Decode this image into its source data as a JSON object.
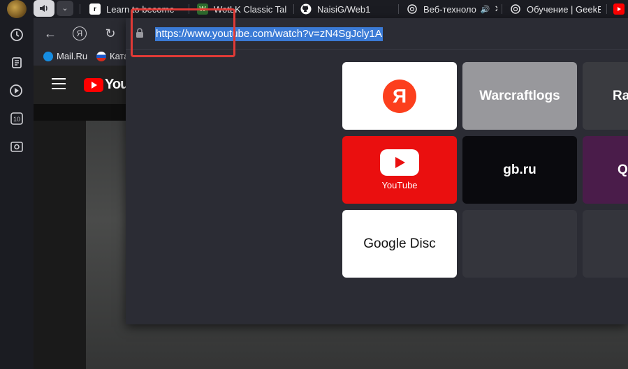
{
  "tabs": [
    {
      "title": "Learn to become",
      "favicon": "r"
    },
    {
      "title": "WotLK Classic Tale",
      "favicon": "W"
    },
    {
      "title": "NaisiG/Web1",
      "favicon": "github"
    },
    {
      "title": "Веб-техноло",
      "favicon": "openai"
    },
    {
      "title": "Обучение | GeekB",
      "favicon": "openai"
    }
  ],
  "toolbar": {
    "back": "←",
    "yandex": "Я",
    "reload": "↻"
  },
  "address": {
    "url": "https://www.youtube.com/watch?v=zN4SgJcly1A"
  },
  "bookmarks": [
    {
      "label": "Mail.Ru"
    },
    {
      "label": "Ката"
    }
  ],
  "youtube": {
    "logo_text": "YouTube"
  },
  "tiles": [
    {
      "label": "Я",
      "type": "yandex"
    },
    {
      "label": "Warcraftlogs",
      "type": "text"
    },
    {
      "label": "Ra",
      "type": "text"
    },
    {
      "label": "YouTube",
      "type": "youtube"
    },
    {
      "label": "gb.ru",
      "type": "text"
    },
    {
      "label": "Q",
      "type": "text"
    },
    {
      "label": "Google Disc",
      "type": "text"
    }
  ],
  "colors": {
    "accent_red": "#e03a36",
    "selection": "#3b7bd6",
    "youtube_red": "#ff0000"
  }
}
